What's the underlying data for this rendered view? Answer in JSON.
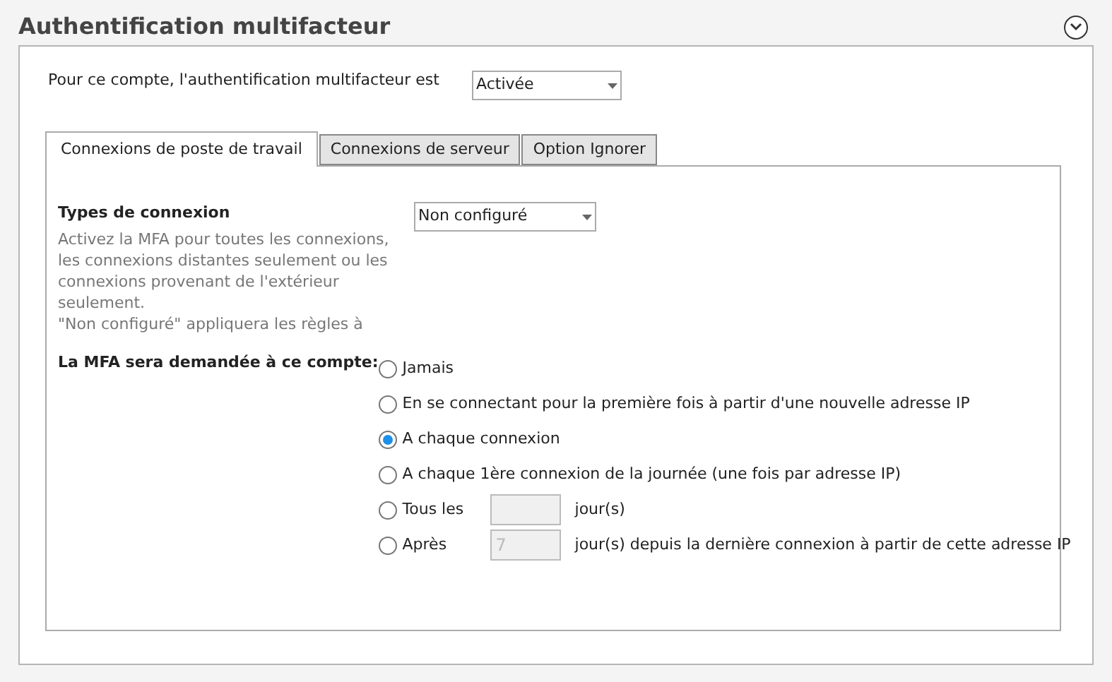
{
  "section": {
    "title": "Authentification multifacteur",
    "expanded": true
  },
  "mfa_status": {
    "label": "Pour ce compte, l'authentification multifacteur est",
    "value": "Activée"
  },
  "tabs": [
    {
      "label": "Connexions de poste de travail",
      "selected": true
    },
    {
      "label": "Connexions de serveur",
      "selected": false
    },
    {
      "label": "Option Ignorer",
      "selected": false
    }
  ],
  "connection_types": {
    "label": "Types de connexion",
    "description": "Activez la MFA pour toutes les connexions, les connexions distantes seulement ou les connexions provenant de l'extérieur seulement.\n\"Non configuré\" appliquera les règles à",
    "value": "Non configuré"
  },
  "mfa_frequency": {
    "label": "La MFA sera demandée à ce compte:",
    "options": [
      {
        "kind": "plain",
        "label": "Jamais",
        "selected": false
      },
      {
        "kind": "plain",
        "label": "En se connectant pour la première fois à partir d'une nouvelle adresse IP",
        "selected": false
      },
      {
        "kind": "plain",
        "label": "A chaque connexion",
        "selected": true
      },
      {
        "kind": "plain",
        "label": "A chaque 1ère connexion de la journée (une fois par adresse IP)",
        "selected": false
      },
      {
        "kind": "field",
        "label": "Tous les",
        "suffix": "jour(s)",
        "selected": false,
        "disabled": true
      },
      {
        "kind": "field",
        "label": "Après",
        "placeholder": "7",
        "suffix": "jour(s) depuis la dernière connexion à partir de cette adresse IP",
        "selected": false,
        "disabled": true
      }
    ]
  }
}
